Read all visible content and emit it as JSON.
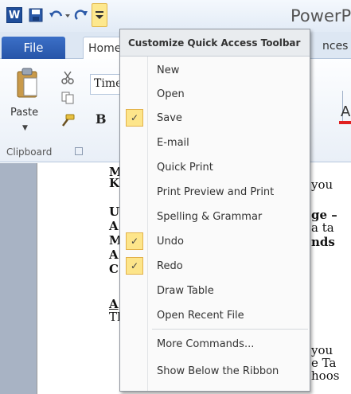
{
  "title_bar": {
    "app_title": "PowerP",
    "word_icon_letter": "W",
    "icons": [
      "word-app-icon",
      "save-icon",
      "undo-icon",
      "redo-icon",
      "customize-dropdown-icon"
    ]
  },
  "tabs": {
    "file": "File",
    "home": "Home",
    "references_partial": "nces"
  },
  "ribbon": {
    "paste_label": "Paste",
    "font_name": "Time",
    "bold_label": "B",
    "clipboard_label": "Clipboard",
    "font_color_label": "A"
  },
  "document": {
    "lines": [
      {
        "text": "M",
        "weight": "bold"
      },
      {
        "text": "K",
        "weight": "bold"
      },
      {
        "text": "U",
        "weight": "bold"
      },
      {
        "text": "A",
        "weight": "bold"
      },
      {
        "text": "M",
        "weight": "bold"
      },
      {
        "text": "A",
        "weight": "bold"
      },
      {
        "text": "C",
        "weight": "bold"
      },
      {
        "text": "A",
        "weight": "bold"
      },
      {
        "text": "Th",
        "weight": "normal"
      }
    ],
    "right_fragments": [
      "you",
      "ge –",
      "a ta",
      "nds",
      "you",
      "e Ta",
      "hoos"
    ]
  },
  "menu": {
    "header": "Customize Quick Access Toolbar",
    "items": [
      {
        "label": "New",
        "checked": false
      },
      {
        "label": "Open",
        "checked": false
      },
      {
        "label": "Save",
        "checked": true
      },
      {
        "label": "E-mail",
        "checked": false
      },
      {
        "label": "Quick Print",
        "checked": false
      },
      {
        "label": "Print Preview and Print",
        "checked": false
      },
      {
        "label": "Spelling & Grammar",
        "checked": false
      },
      {
        "label": "Undo",
        "checked": true
      },
      {
        "label": "Redo",
        "checked": true
      },
      {
        "label": "Draw Table",
        "checked": false
      },
      {
        "label": "Open Recent File",
        "checked": false
      }
    ],
    "more_commands": "More Commands...",
    "show_below": "Show Below the Ribbon",
    "check_glyph": "✓"
  },
  "colors": {
    "file_tab": "#2f63b8",
    "checked_highlight": "#fde58a",
    "font_color_underline": "#e02020"
  }
}
